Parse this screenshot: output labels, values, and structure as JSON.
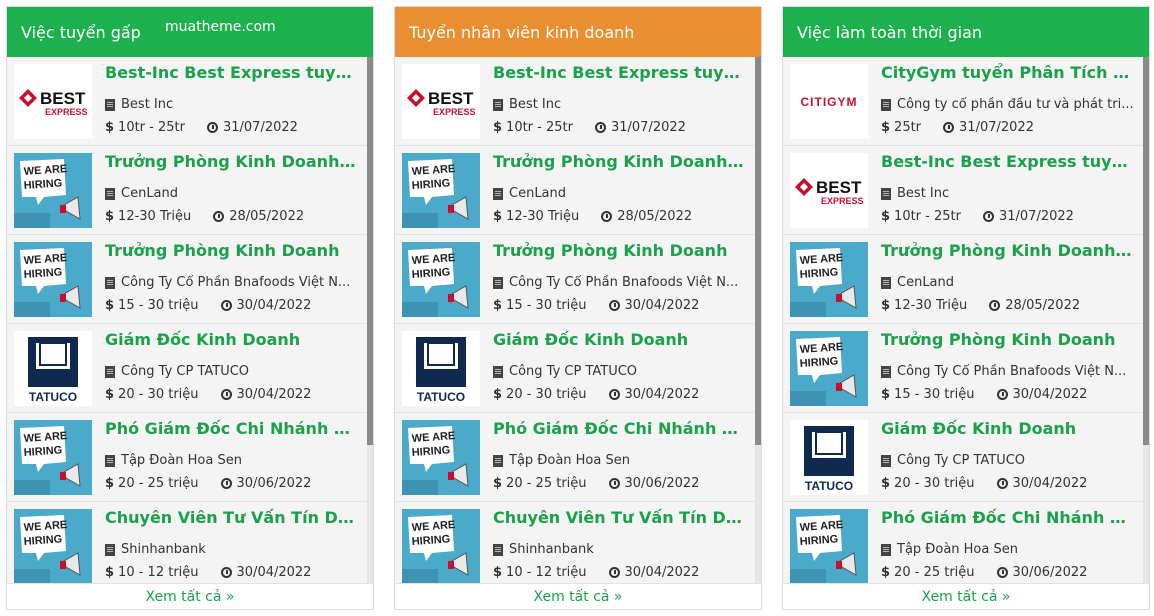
{
  "panels": [
    {
      "title": "Việc tuyển gấp",
      "header_color": "#1db04f",
      "watermark": "muatheme.com",
      "jobs": [
        {
          "title": "Best-Inc Best Express tuyển d...",
          "company": "Best Inc",
          "salary": "10tr - 25tr",
          "date": "31/07/2022",
          "logo": "best-express-logo"
        },
        {
          "title": "Trưởng Phòng Kinh Doanh Lư...",
          "company": "CenLand",
          "salary": "12-30 Triệu",
          "date": "28/05/2022",
          "logo": "we-are-hiring-logo"
        },
        {
          "title": "Trưởng Phòng Kinh Doanh",
          "company": "Công Ty Cổ Phần Bnafoods Việt N...",
          "salary": "15 - 30 triệu",
          "date": "30/04/2022",
          "logo": "we-are-hiring-logo"
        },
        {
          "title": "Giám Đốc Kinh Doanh",
          "company": "Công Ty CP TATUCO",
          "salary": "20 - 30 triệu",
          "date": "30/04/2022",
          "logo": "tatuco-logo"
        },
        {
          "title": "Phó Giám Đốc Chi Nhánh Tỉnh...",
          "company": "Tập Đoàn Hoa Sen",
          "salary": "20 - 25 triệu",
          "date": "30/06/2022",
          "logo": "we-are-hiring-logo"
        },
        {
          "title": "Chuyên Viên Tư Vấn Tín Dụng...",
          "company": "Shinhanbank",
          "salary": "10 - 12 triệu",
          "date": "30/04/2022",
          "logo": "we-are-hiring-logo"
        }
      ],
      "footer": "Xem tất cả »"
    },
    {
      "title": "Tuyển nhân viên kinh doanh",
      "header_color": "#e98e31",
      "jobs": [
        {
          "title": "Best-Inc Best Express tuyển d...",
          "company": "Best Inc",
          "salary": "10tr - 25tr",
          "date": "31/07/2022",
          "logo": "best-express-logo"
        },
        {
          "title": "Trưởng Phòng Kinh Doanh Lư...",
          "company": "CenLand",
          "salary": "12-30 Triệu",
          "date": "28/05/2022",
          "logo": "we-are-hiring-logo"
        },
        {
          "title": "Trưởng Phòng Kinh Doanh",
          "company": "Công Ty Cổ Phần Bnafoods Việt N...",
          "salary": "15 - 30 triệu",
          "date": "30/04/2022",
          "logo": "we-are-hiring-logo"
        },
        {
          "title": "Giám Đốc Kinh Doanh",
          "company": "Công Ty CP TATUCO",
          "salary": "20 - 30 triệu",
          "date": "30/04/2022",
          "logo": "tatuco-logo"
        },
        {
          "title": "Phó Giám Đốc Chi Nhánh Tỉnh...",
          "company": "Tập Đoàn Hoa Sen",
          "salary": "20 - 25 triệu",
          "date": "30/06/2022",
          "logo": "we-are-hiring-logo"
        },
        {
          "title": "Chuyên Viên Tư Vấn Tín Dụng...",
          "company": "Shinhanbank",
          "salary": "10 - 12 triệu",
          "date": "30/04/2022",
          "logo": "we-are-hiring-logo"
        }
      ],
      "footer": "Xem tất cả »"
    },
    {
      "title": "Việc làm toàn thời gian",
      "header_color": "#1db04f",
      "jobs": [
        {
          "title": "CityGym tuyển Phân Tích Ngh...",
          "company": "Công ty cổ phần đầu tư và phát tri...",
          "salary": "25tr",
          "date": "31/07/2022",
          "logo": "citigym-logo"
        },
        {
          "title": "Best-Inc Best Express tuyển d...",
          "company": "Best Inc",
          "salary": "10tr - 25tr",
          "date": "31/07/2022",
          "logo": "best-express-logo"
        },
        {
          "title": "Trưởng Phòng Kinh Doanh Lư...",
          "company": "CenLand",
          "salary": "12-30 Triệu",
          "date": "28/05/2022",
          "logo": "we-are-hiring-logo"
        },
        {
          "title": "Trưởng Phòng Kinh Doanh",
          "company": "Công Ty Cổ Phần Bnafoods Việt N...",
          "salary": "15 - 30 triệu",
          "date": "30/04/2022",
          "logo": "we-are-hiring-logo"
        },
        {
          "title": "Giám Đốc Kinh Doanh",
          "company": "Công Ty CP TATUCO",
          "salary": "20 - 30 triệu",
          "date": "30/04/2022",
          "logo": "tatuco-logo"
        },
        {
          "title": "Phó Giám Đốc Chi Nhánh Tỉnh...",
          "company": "Tập Đoàn Hoa Sen",
          "salary": "20 - 25 triệu",
          "date": "30/06/2022",
          "logo": "we-are-hiring-logo"
        }
      ],
      "footer": "Xem tất cả »"
    }
  ],
  "logo_text": {
    "best_top": "BEST",
    "best_bottom": "EXPRESS",
    "hiring_line1": "WE ARE",
    "hiring_line2": "HIRING",
    "tatuco": "TATUCO",
    "citigym": "CITIGYM"
  },
  "colors": {
    "title_green": "#1aa14a",
    "best_red": "#c8102e",
    "hiring_blue": "#4ba9c9",
    "tatuco_navy": "#0f2a4e"
  }
}
